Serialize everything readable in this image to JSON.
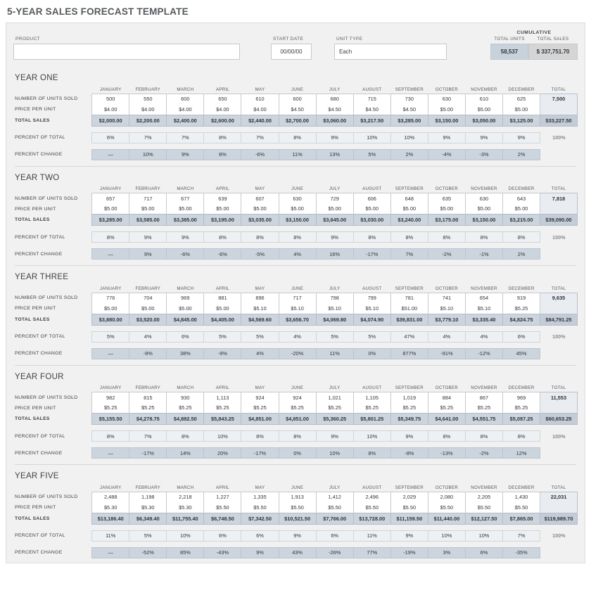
{
  "page_title": "5-YEAR SALES FORECAST TEMPLATE",
  "header": {
    "product_label": "PRODUCT",
    "product_value": "",
    "start_date_label": "START DATE",
    "start_date_value": "00/00/00",
    "unit_type_label": "UNIT TYPE",
    "unit_type_value": "Each",
    "cumulative_label": "CUMULATIVE",
    "total_units_label": "TOTAL UNITS",
    "total_units_value": "58,537",
    "total_sales_label": "TOTAL SALES",
    "total_sales_value": "$ 337,751.70"
  },
  "months": [
    "JANUARY",
    "FEBRUARY",
    "MARCH",
    "APRIL",
    "MAY",
    "JUNE",
    "JULY",
    "AUGUST",
    "SEPTEMBER",
    "OCTOBER",
    "NOVEMBER",
    "DECEMBER"
  ],
  "total_column_label": "TOTAL",
  "row_labels": {
    "units": "NUMBER OF UNITS SOLD",
    "price": "PRICE PER UNIT",
    "sales": "TOTAL SALES",
    "percent_of_total": "PERCENT OF TOTAL",
    "percent_change": "PERCENT CHANGE"
  },
  "colors": {
    "accent_total_sales": "#ccd4dd",
    "accent_percent_of_total": "#eef1f4",
    "accent_total_column": "#e9edf1",
    "sheet_background": "#f1f1f1",
    "title_text": "#55595c"
  },
  "chart_data": {
    "type": "table",
    "title": "5-YEAR SALES FORECAST TEMPLATE",
    "categories": [
      "JANUARY",
      "FEBRUARY",
      "MARCH",
      "APRIL",
      "MAY",
      "JUNE",
      "JULY",
      "AUGUST",
      "SEPTEMBER",
      "OCTOBER",
      "NOVEMBER",
      "DECEMBER"
    ],
    "years": [
      {
        "name": "YEAR ONE",
        "units": [
          "500",
          "550",
          "600",
          "650",
          "610",
          "600",
          "680",
          "715",
          "730",
          "630",
          "610",
          "625"
        ],
        "units_total": "7,500",
        "price": [
          "$4.00",
          "$4.00",
          "$4.00",
          "$4.00",
          "$4.00",
          "$4.50",
          "$4.50",
          "$4.50",
          "$4.50",
          "$5.00",
          "$5.00",
          "$5.00"
        ],
        "price_total": "",
        "sales": [
          "$2,000.00",
          "$2,200.00",
          "$2,400.00",
          "$2,600.00",
          "$2,440.00",
          "$2,700.00",
          "$3,060.00",
          "$3,217.50",
          "$3,285.00",
          "$3,150.00",
          "$3,050.00",
          "$3,125.00"
        ],
        "sales_total": "$33,227.50",
        "percent_of_total": [
          "6%",
          "7%",
          "7%",
          "8%",
          "7%",
          "8%",
          "9%",
          "10%",
          "10%",
          "9%",
          "9%",
          "9%"
        ],
        "percent_of_total_total": "100%",
        "percent_change": [
          "—",
          "10%",
          "9%",
          "8%",
          "-6%",
          "11%",
          "13%",
          "5%",
          "2%",
          "-4%",
          "-3%",
          "2%"
        ]
      },
      {
        "name": "YEAR TWO",
        "units": [
          "657",
          "717",
          "677",
          "639",
          "607",
          "630",
          "729",
          "606",
          "648",
          "635",
          "630",
          "643"
        ],
        "units_total": "7,818",
        "price": [
          "$5.00",
          "$5.00",
          "$5.00",
          "$5.00",
          "$5.00",
          "$5.00",
          "$5.00",
          "$5.00",
          "$5.00",
          "$5.00",
          "$5.00",
          "$5.00"
        ],
        "price_total": "",
        "sales": [
          "$3,285.00",
          "$3,585.00",
          "$3,385.00",
          "$3,195.00",
          "$3,035.00",
          "$3,150.00",
          "$3,645.00",
          "$3,030.00",
          "$3,240.00",
          "$3,175.00",
          "$3,150.00",
          "$3,215.00"
        ],
        "sales_total": "$39,090.00",
        "percent_of_total": [
          "8%",
          "9%",
          "9%",
          "8%",
          "8%",
          "8%",
          "9%",
          "8%",
          "8%",
          "8%",
          "8%",
          "8%"
        ],
        "percent_of_total_total": "100%",
        "percent_change": [
          "—",
          "9%",
          "-6%",
          "-6%",
          "-5%",
          "4%",
          "16%",
          "-17%",
          "7%",
          "-2%",
          "-1%",
          "2%"
        ]
      },
      {
        "name": "YEAR THREE",
        "units": [
          "776",
          "704",
          "969",
          "881",
          "896",
          "717",
          "798",
          "799",
          "781",
          "741",
          "654",
          "919"
        ],
        "units_total": "9,635",
        "price": [
          "$5.00",
          "$5.00",
          "$5.00",
          "$5.00",
          "$5.10",
          "$5.10",
          "$5.10",
          "$5.10",
          "$51.00",
          "$5.10",
          "$5.10",
          "$5.25"
        ],
        "price_total": "",
        "sales": [
          "$3,880.00",
          "$3,520.00",
          "$4,845.00",
          "$4,405.00",
          "$4,569.60",
          "$3,656.70",
          "$4,069.80",
          "$4,074.90",
          "$39,831.00",
          "$3,779.10",
          "$3,335.40",
          "$4,824.75"
        ],
        "sales_total": "$84,791.25",
        "percent_of_total": [
          "5%",
          "4%",
          "6%",
          "5%",
          "5%",
          "4%",
          "5%",
          "5%",
          "47%",
          "4%",
          "4%",
          "6%"
        ],
        "percent_of_total_total": "100%",
        "percent_change": [
          "—",
          "-9%",
          "38%",
          "-9%",
          "4%",
          "-20%",
          "11%",
          "0%",
          "877%",
          "-91%",
          "-12%",
          "45%"
        ]
      },
      {
        "name": "YEAR FOUR",
        "units": [
          "982",
          "815",
          "930",
          "1,113",
          "924",
          "924",
          "1,021",
          "1,105",
          "1,019",
          "884",
          "867",
          "969"
        ],
        "units_total": "11,553",
        "price": [
          "$5.25",
          "$5.25",
          "$5.25",
          "$5.25",
          "$5.25",
          "$5.25",
          "$5.25",
          "$5.25",
          "$5.25",
          "$5.25",
          "$5.25",
          "$5.25"
        ],
        "price_total": "",
        "sales": [
          "$5,155.50",
          "$4,278.75",
          "$4,882.50",
          "$5,843.25",
          "$4,851.00",
          "$4,851.00",
          "$5,360.25",
          "$5,801.25",
          "$5,349.75",
          "$4,641.00",
          "$4,551.75",
          "$5,087.25"
        ],
        "sales_total": "$60,653.25",
        "percent_of_total": [
          "8%",
          "7%",
          "8%",
          "10%",
          "8%",
          "8%",
          "9%",
          "10%",
          "9%",
          "8%",
          "8%",
          "8%"
        ],
        "percent_of_total_total": "100%",
        "percent_change": [
          "—",
          "-17%",
          "14%",
          "20%",
          "-17%",
          "0%",
          "10%",
          "8%",
          "-8%",
          "-13%",
          "-2%",
          "12%"
        ]
      },
      {
        "name": "YEAR FIVE",
        "units": [
          "2,488",
          "1,198",
          "2,218",
          "1,227",
          "1,335",
          "1,913",
          "1,412",
          "2,496",
          "2,029",
          "2,080",
          "2,205",
          "1,430"
        ],
        "units_total": "22,031",
        "price": [
          "$5.30",
          "$5.30",
          "$5.30",
          "$5.50",
          "$5.50",
          "$5.50",
          "$5.50",
          "$5.50",
          "$5.50",
          "$5.50",
          "$5.50",
          "$5.50"
        ],
        "price_total": "",
        "sales": [
          "$13,186.40",
          "$6,349.40",
          "$11,755.40",
          "$6,748.50",
          "$7,342.50",
          "$10,521.50",
          "$7,766.00",
          "$13,728.00",
          "$11,159.50",
          "$11,440.00",
          "$12,127.50",
          "$7,865.00"
        ],
        "sales_total": "$119,989.70",
        "percent_of_total": [
          "11%",
          "5%",
          "10%",
          "6%",
          "6%",
          "9%",
          "6%",
          "11%",
          "9%",
          "10%",
          "10%",
          "7%"
        ],
        "percent_of_total_total": "100%",
        "percent_change": [
          "—",
          "-52%",
          "85%",
          "-43%",
          "9%",
          "43%",
          "-26%",
          "77%",
          "-19%",
          "3%",
          "6%",
          "-35%"
        ]
      }
    ]
  }
}
